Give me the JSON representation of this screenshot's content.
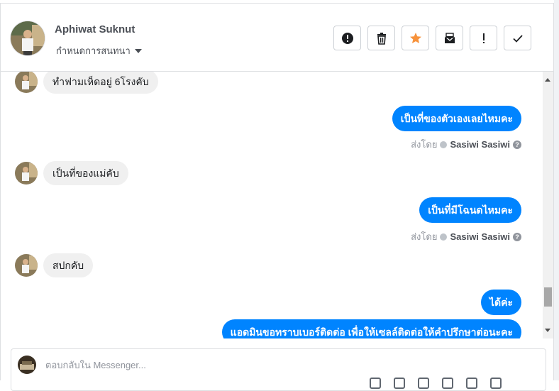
{
  "header": {
    "contact_name": "Aphiwat Suknut",
    "assign_label": "กำหนดการสนทนา",
    "actions": [
      {
        "name": "report-button",
        "icon": "exclamation-circle-icon"
      },
      {
        "name": "delete-button",
        "icon": "trash-icon"
      },
      {
        "name": "star-button",
        "icon": "star-icon",
        "color": "#f7923b"
      },
      {
        "name": "mark-unread-button",
        "icon": "envelope-open-icon"
      },
      {
        "name": "flag-button",
        "icon": "exclamation-icon"
      },
      {
        "name": "mark-done-button",
        "icon": "check-icon"
      }
    ]
  },
  "thread": {
    "messages": [
      {
        "dir": "in",
        "text": "ทำฟามเห็ดอยู่ 6โรงคับ"
      },
      {
        "dir": "out",
        "text": "เป็นที่ของตัวเองเลยไหมคะ",
        "sent_by_label": "ส่งโดย",
        "sender": "Sasiwi Sasiwi"
      },
      {
        "dir": "in",
        "text": "เป็นที่ของแม่คับ"
      },
      {
        "dir": "out",
        "text": "เป็นที่มีโฉนดไหมคะ",
        "sent_by_label": "ส่งโดย",
        "sender": "Sasiwi Sasiwi"
      },
      {
        "dir": "in",
        "text": "สปกคับ"
      },
      {
        "dir": "out",
        "text": "ได้ค่ะ"
      },
      {
        "dir": "out",
        "text": "แอดมินขอทราบเบอร์ติดต่อ เพื่อให้เซลล์ติดต่อให้คำปรึกษาต่อนะคะ"
      }
    ]
  },
  "composer": {
    "placeholder": "ตอบกลับใน Messenger..."
  },
  "colors": {
    "outgoing_bubble": "#0084ff",
    "incoming_bubble": "#f0f0f0",
    "star": "#f7923b"
  }
}
